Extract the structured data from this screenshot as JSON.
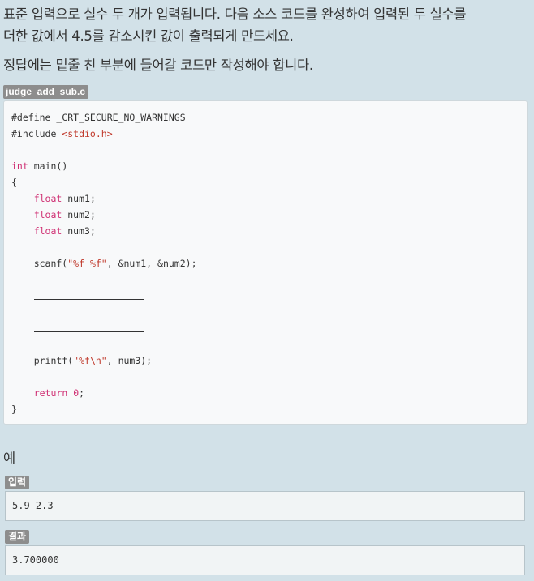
{
  "problem": {
    "description_line1": "표준 입력으로 실수 두 개가 입력됩니다. 다음 소스 코드를 완성하여 입력된 두 실수를",
    "description_line2": "더한 값에서 4.5를 감소시킨 값이 출력되게 만드세요.",
    "instruction": "정답에는 밑줄 친 부분에 들어갈 코드만 작성해야 합니다."
  },
  "code_file": {
    "filename": "judge_add_sub.c",
    "lines": [
      [
        {
          "t": "#define _CRT_SECURE_NO_WARNINGS",
          "c": "plain"
        }
      ],
      [
        {
          "t": "#include ",
          "c": "plain"
        },
        {
          "t": "<stdio.h>",
          "c": "str"
        }
      ],
      [],
      [
        {
          "t": "int",
          "c": "kw"
        },
        {
          "t": " main()",
          "c": "plain"
        }
      ],
      [
        {
          "t": "{",
          "c": "plain"
        }
      ],
      [
        {
          "t": "    ",
          "c": "plain"
        },
        {
          "t": "float",
          "c": "kw"
        },
        {
          "t": " num1;",
          "c": "plain"
        }
      ],
      [
        {
          "t": "    ",
          "c": "plain"
        },
        {
          "t": "float",
          "c": "kw"
        },
        {
          "t": " num2;",
          "c": "plain"
        }
      ],
      [
        {
          "t": "    ",
          "c": "plain"
        },
        {
          "t": "float",
          "c": "kw"
        },
        {
          "t": " num3;",
          "c": "plain"
        }
      ],
      [],
      [
        {
          "t": "    scanf(",
          "c": "plain"
        },
        {
          "t": "\"%f %f\"",
          "c": "str"
        },
        {
          "t": ", &num1, &num2);",
          "c": "plain"
        }
      ],
      [],
      [
        {
          "t": "    ",
          "c": "plain"
        },
        {
          "t": "",
          "c": "blank"
        }
      ],
      [],
      [
        {
          "t": "    ",
          "c": "plain"
        },
        {
          "t": "",
          "c": "blank"
        }
      ],
      [],
      [
        {
          "t": "    printf(",
          "c": "plain"
        },
        {
          "t": "\"%f\\n\"",
          "c": "str"
        },
        {
          "t": ", num3);",
          "c": "plain"
        }
      ],
      [],
      [
        {
          "t": "    ",
          "c": "plain"
        },
        {
          "t": "return",
          "c": "kw"
        },
        {
          "t": " ",
          "c": "plain"
        },
        {
          "t": "0",
          "c": "num"
        },
        {
          "t": ";",
          "c": "plain"
        }
      ],
      [
        {
          "t": "}",
          "c": "plain"
        }
      ]
    ]
  },
  "example": {
    "heading": "예",
    "input_label": "입력",
    "input_value": "5.9 2.3",
    "output_label": "결과",
    "output_value": "3.700000"
  },
  "colors": {
    "background": "#d2e1e8",
    "keyword": "#cf2f73",
    "string": "#c0392b",
    "badge": "#8d8d8d"
  }
}
